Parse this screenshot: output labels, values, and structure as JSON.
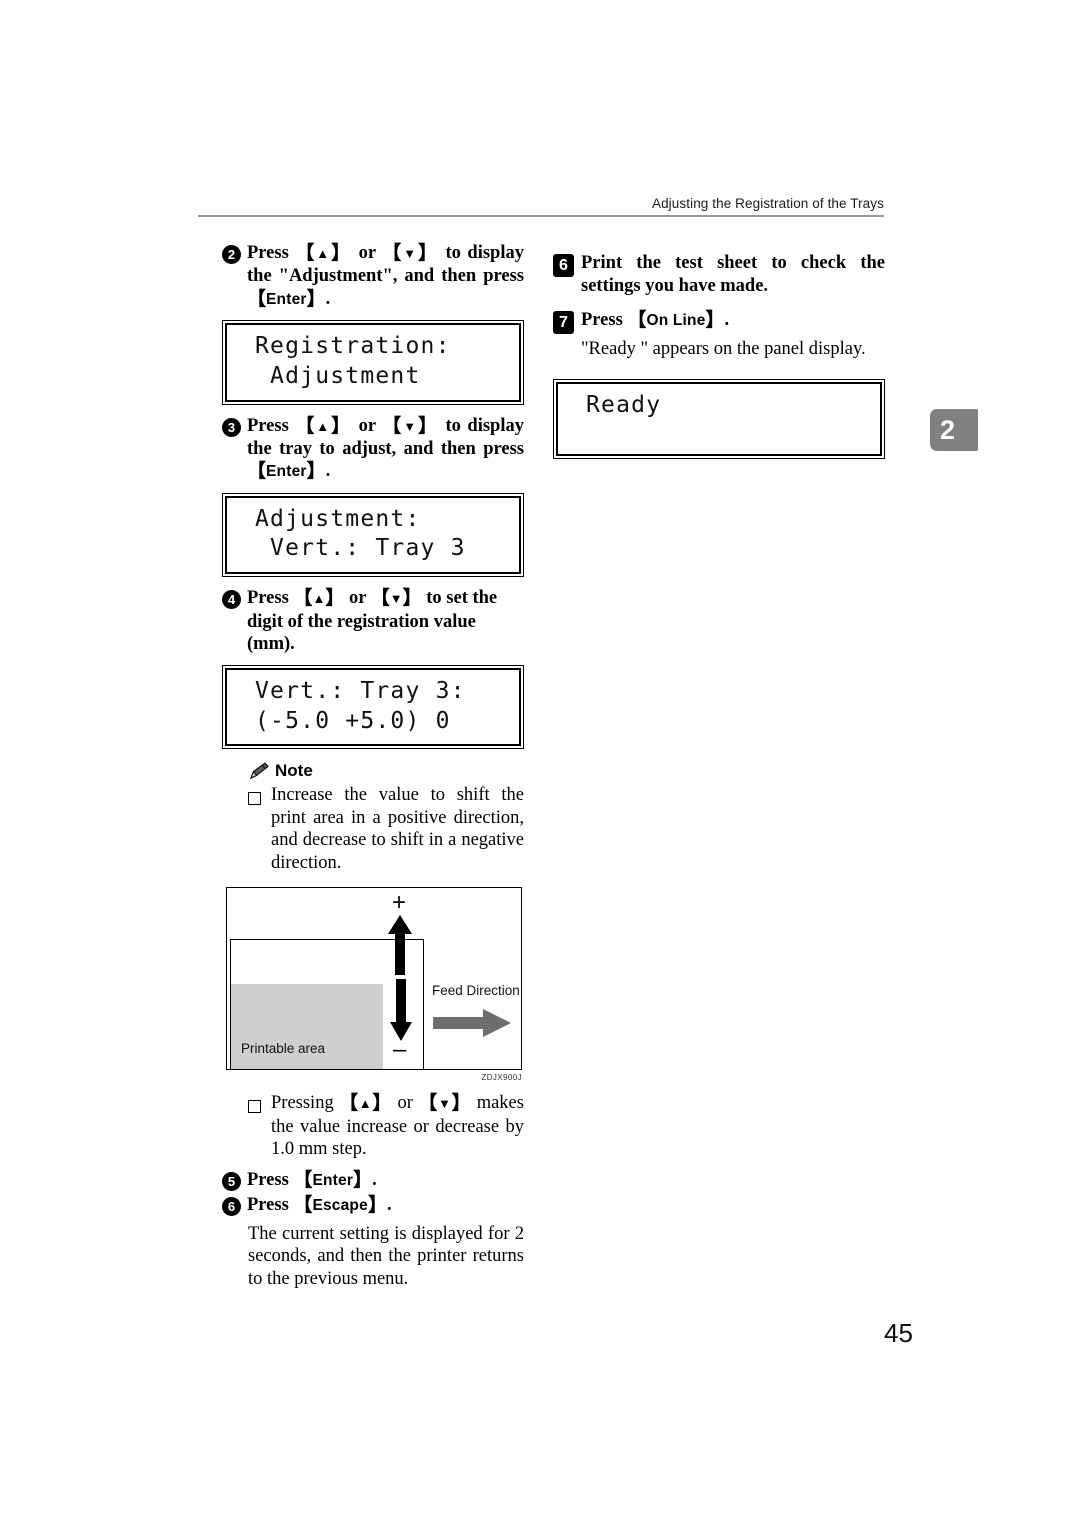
{
  "header": {
    "running_title": "Adjusting the Registration of the Trays"
  },
  "chapter_tab": {
    "number": "2",
    "color": "#808080",
    "text_color": "#ffffff"
  },
  "page_number": "45",
  "keys": {
    "up": "▲",
    "down": "▼",
    "enter": "Enter",
    "escape": "Escape",
    "online": "On Line",
    "bracket_open": "【",
    "bracket_close": "】"
  },
  "left_column": {
    "steps": [
      {
        "number": "2",
        "badge": "circle",
        "parts": {
          "p1": "Press ",
          "p2": " or ",
          "p3": " to display the \"Adjustment\", and then press ",
          "p4": "."
        }
      },
      {
        "number": "3",
        "badge": "circle",
        "parts": {
          "p1": "Press ",
          "p2": " or ",
          "p3": " to display the tray to adjust, and then press ",
          "p4": "."
        }
      },
      {
        "number": "4",
        "badge": "circle",
        "parts": {
          "p1": "Press ",
          "p2": " or ",
          "p3": " to set the digit of the registration value (mm).",
          "p4": ""
        }
      },
      {
        "number": "5",
        "badge": "circle",
        "parts": {
          "p1": "Press ",
          "p2": "",
          "p3": "",
          "p4": "."
        }
      },
      {
        "number": "6",
        "badge": "circle",
        "parts": {
          "p1": "Press ",
          "p2": "",
          "p3": "",
          "p4": "."
        }
      }
    ],
    "lcd_1": {
      "line1": "Registration:",
      "line2": " Adjustment"
    },
    "lcd_2": {
      "line1": "Adjustment:",
      "line2": " Vert.: Tray 3"
    },
    "lcd_3": {
      "line1": "Vert.: Tray 3:",
      "line2": "(-5.0 +5.0) 0"
    },
    "note": {
      "label": "Note",
      "items": [
        "Increase the value to shift the print area in a positive direction, and decrease to shift in a negative direction.",
        {
          "p1": "Pressing ",
          "p2": " or ",
          "p3": " makes the value increase or decrease by 1.0 mm step."
        }
      ]
    },
    "figure": {
      "printable_area_label": "Printable area",
      "feed_direction_label": "Feed Direction",
      "plus_sign": "+",
      "minus_sign": "–",
      "code": "ZDJX900J"
    },
    "closing_paragraph": "The current setting is displayed for 2 seconds, and then the printer returns to the previous menu."
  },
  "right_column": {
    "steps": [
      {
        "number": "6",
        "badge": "square",
        "text": "Print the test sheet to check the settings you have made."
      },
      {
        "number": "7",
        "badge": "square",
        "parts": {
          "p1": "Press ",
          "p2": "."
        }
      }
    ],
    "body_paragraph": "\"Ready \" appears on the panel display.",
    "lcd_ready": {
      "line1": "Ready",
      "line2": ""
    }
  }
}
